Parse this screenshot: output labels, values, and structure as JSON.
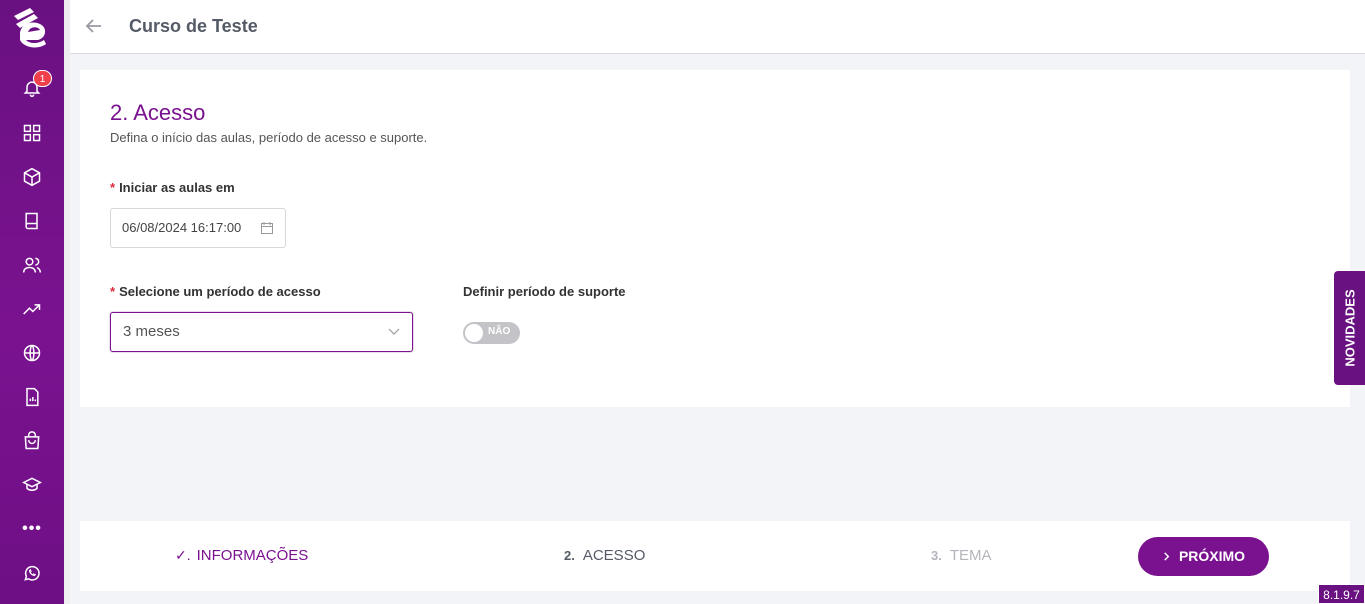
{
  "header": {
    "title": "Curso de Teste"
  },
  "sidebar": {
    "notifications_count": "1",
    "icons": [
      "bell-icon",
      "grid-icon",
      "cube-icon",
      "book-icon",
      "users-icon",
      "trending-icon",
      "globe-icon",
      "report-icon",
      "bag-icon",
      "graduation-cap-icon",
      "more-icon",
      "whatsapp-icon"
    ],
    "more_label": "•••"
  },
  "section": {
    "title": "2. Acesso",
    "subtitle": "Defina o início das aulas, período de acesso e suporte."
  },
  "form": {
    "start_label": "Iniciar as aulas em",
    "start_value": "06/08/2024 16:17:00",
    "period_label": "Selecione um período de acesso",
    "period_value": "3 meses",
    "support_label": "Definir período de suporte",
    "support_toggle": "NÃO",
    "required_mark": "*"
  },
  "novidades": "NOVIDADES",
  "stepper": {
    "step1": {
      "check": "✓.",
      "label": "INFORMAÇÕES"
    },
    "step2": {
      "num": "2.",
      "label": "ACESSO"
    },
    "step3": {
      "num": "3.",
      "label": "TEMA"
    },
    "next_label": "PRÓXIMO"
  },
  "version": "8.1.9.7",
  "colors": {
    "brand": "#7a128f",
    "sidebar": "#6a1182",
    "badge": "#f0404b"
  }
}
